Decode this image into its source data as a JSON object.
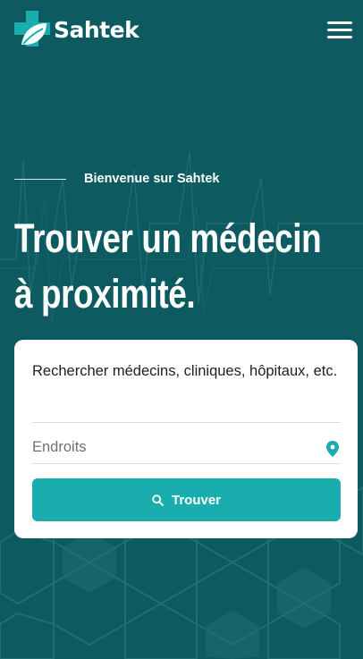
{
  "brand": {
    "name": "Sahtek"
  },
  "hero": {
    "kicker": "Bienvenue sur Sahtek",
    "title_line1": "Trouver un médecin",
    "title_line2": "à proximité."
  },
  "search": {
    "query_text": "Rechercher médecins, cliniques, hôpitaux, etc.",
    "location_placeholder": "Endroits",
    "location_value": "",
    "button_label": "Trouver"
  },
  "colors": {
    "background": "#0d5b60",
    "accent": "#1aadb0",
    "card": "#ffffff",
    "text": "#1f1f1f"
  },
  "icons": [
    "logo-cross-leaf-icon",
    "hamburger-menu-icon",
    "location-pin-icon",
    "search-icon"
  ]
}
